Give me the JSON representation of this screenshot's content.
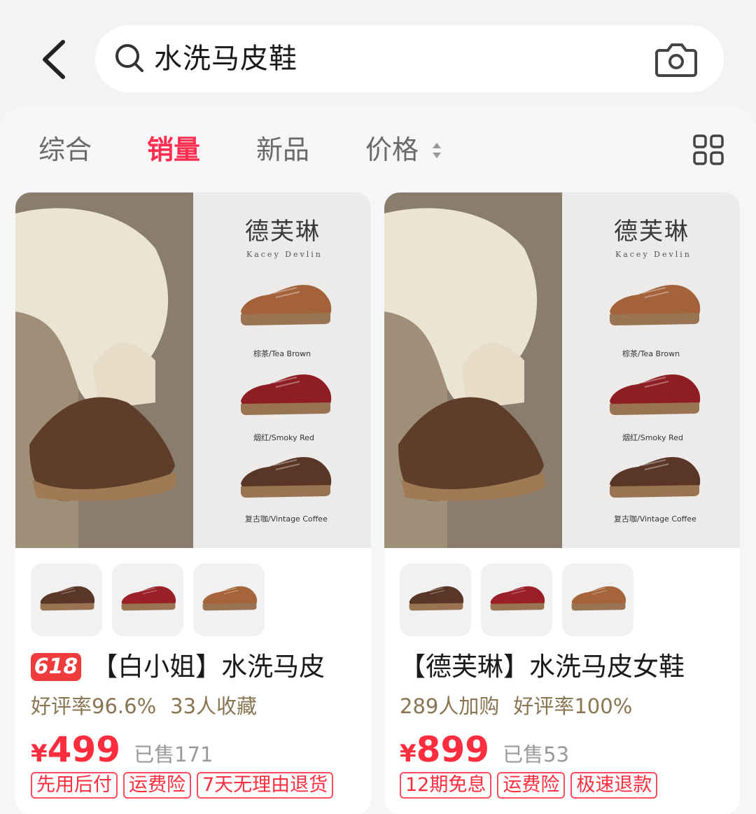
{
  "search": {
    "query": "水洗马皮鞋"
  },
  "icons": {
    "back": "chevron-left-icon",
    "search": "search-icon",
    "camera": "camera-icon",
    "grid": "grid-view-icon",
    "sort": "sort-arrows-icon"
  },
  "sort_tabs": [
    {
      "label": "综合",
      "active": false
    },
    {
      "label": "销量",
      "active": true
    },
    {
      "label": "新品",
      "active": false
    },
    {
      "label": "价格",
      "active": false
    }
  ],
  "colors": {
    "accent": "#ff2d4f",
    "price": "#ff2d3d",
    "meta": "#8a7552"
  },
  "products": [
    {
      "hero": {
        "brand_cn": "德芙琳",
        "brand_en": "Kacey Devlin",
        "colorways": [
          "棕茶/Tea Brown",
          "烟红/Smoky Red",
          "复古咖/Vintage Coffee"
        ]
      },
      "badge": "618",
      "title": "【白小姐】水洗马皮",
      "meta": [
        "好评率96.6%",
        "33人收藏"
      ],
      "price_symbol": "¥",
      "price": "499",
      "sold": "已售171",
      "tags": [
        "先用后付",
        "运费险",
        "7天无理由退货"
      ]
    },
    {
      "hero": {
        "brand_cn": "德芙琳",
        "brand_en": "Kacey Devlin",
        "colorways": [
          "棕茶/Tea Brown",
          "烟红/Smoky Red",
          "复古咖/Vintage Coffee"
        ]
      },
      "title": "【德芙琳】水洗马皮女鞋",
      "meta": [
        "289人加购",
        "好评率100%"
      ],
      "price_symbol": "¥",
      "price": "899",
      "sold": "已售53",
      "tags": [
        "12期免息",
        "运费险",
        "极速退款"
      ]
    }
  ]
}
